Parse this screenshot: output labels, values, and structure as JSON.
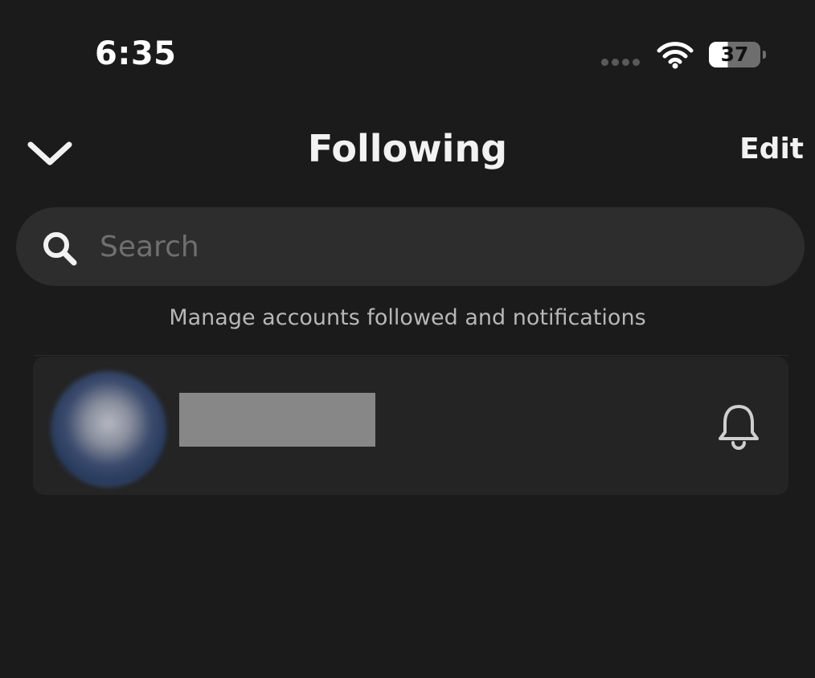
{
  "status_bar": {
    "time": "6:35",
    "battery_level": "37",
    "icons": [
      "signal-dots-icon",
      "wifi-icon",
      "battery-icon"
    ]
  },
  "header": {
    "title": "Following",
    "edit_label": "Edit",
    "back_icon": "chevron-down-icon"
  },
  "search": {
    "placeholder": "Search",
    "value": "",
    "icon": "search-icon"
  },
  "helper_text": "Manage accounts followed and notifications",
  "accounts": [
    {
      "avatar": "avatar",
      "name_redacted": true,
      "action_icon": "bell-icon"
    }
  ],
  "colors": {
    "background": "#1b1b1b",
    "search_bg": "#2d2d2d",
    "card_bg": "#242424",
    "text_primary": "#f2f2f2",
    "text_secondary": "#b7b7b7",
    "placeholder": "#6f6f6f",
    "redaction": "#878787"
  }
}
